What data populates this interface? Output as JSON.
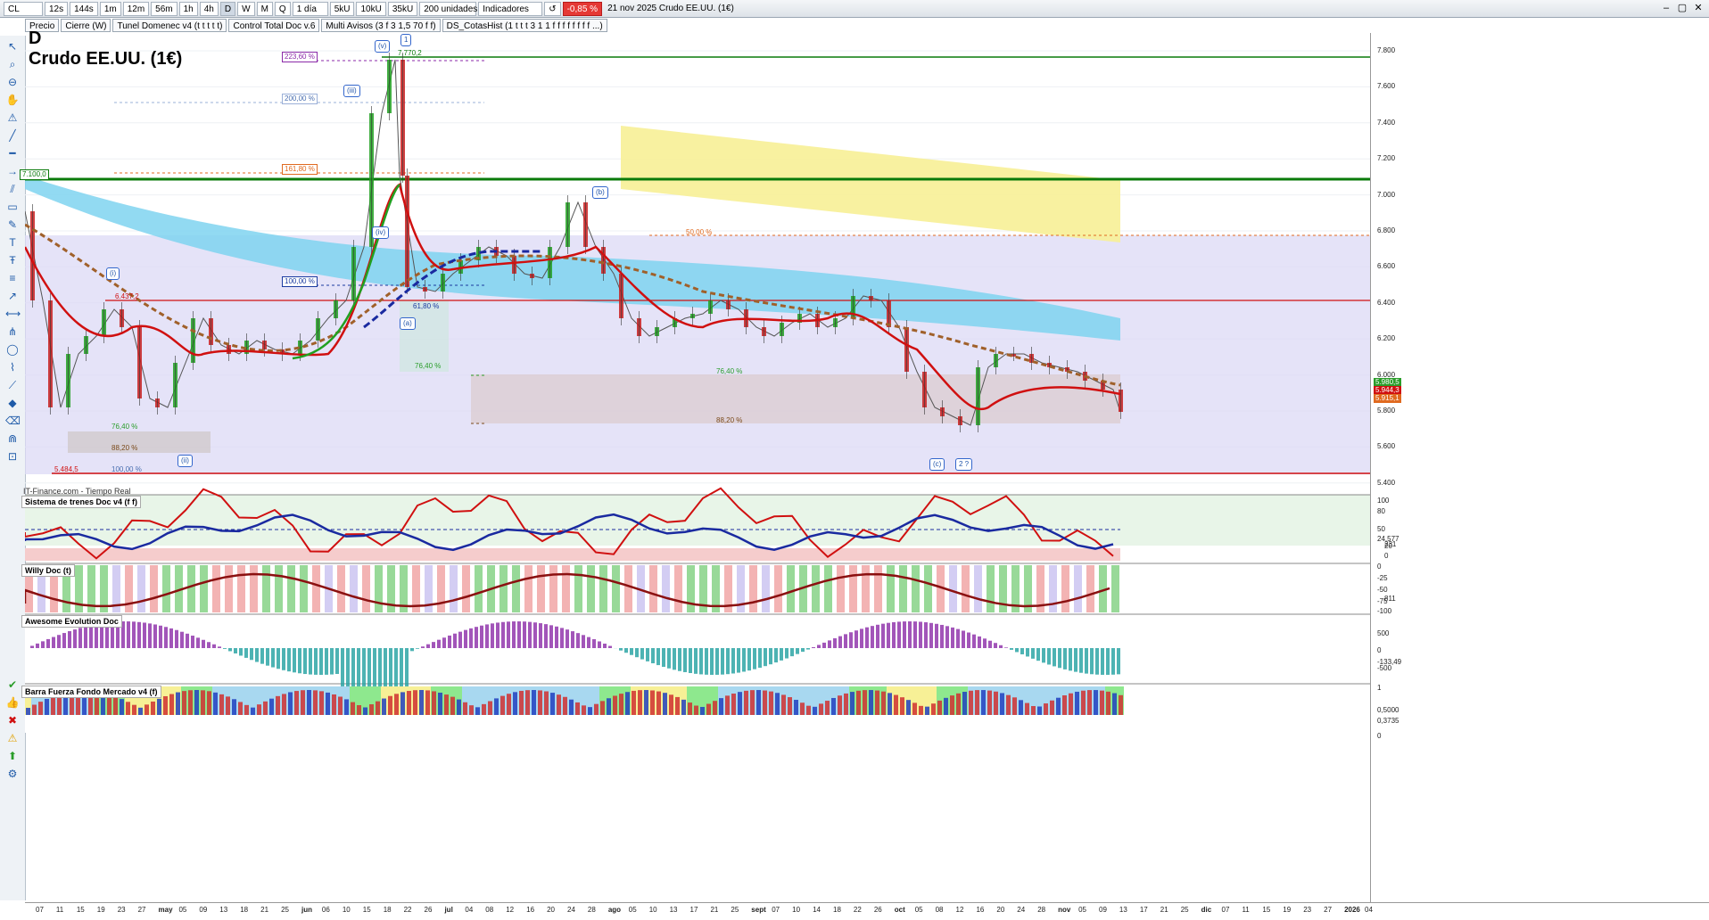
{
  "toolbar": {
    "symbol": "CL",
    "timeframes": [
      "12s",
      "144s",
      "1m",
      "12m",
      "56m",
      "1h",
      "4h",
      "D",
      "W",
      "M",
      "Q"
    ],
    "interval": "1 día",
    "units": [
      "5kU",
      "10kU",
      "35kU"
    ],
    "quantity": "200 unidades",
    "indicators_label": "Indicadores",
    "change_pct": "-0,85 %",
    "header_text": "21 nov 2025 Crudo EE.UU. (1€)"
  },
  "indicator_tabs": [
    "Precio",
    "Cierre (W)",
    "Tunel Domenec v4 (t t t t t)",
    "Control Total Doc v.6",
    "Multi Avisos (3 f 3 1,5 70 f f)",
    "DS_CotasHist (1 t t t 3 1 1 f f f f f f f f ...)"
  ],
  "chart": {
    "interval_code": "D",
    "instrument_name": "Crudo EE.UU. (1€)",
    "data_source": "IT-Finance.com - Tiempo Real"
  },
  "panels": [
    {
      "title": "Sistema de trenes Doc v4 (f f)"
    },
    {
      "title": "Willy Doc (t)"
    },
    {
      "title": "Awesome Evolution Doc"
    },
    {
      "title": "Barra Fuerza Fondo Mercado v4 (f)"
    }
  ],
  "fib_labels": [
    "223,60 %",
    "200,00 %",
    "161,80 %",
    "100,00 %",
    "61,80 %",
    "76,40 %",
    "50,00 %",
    "76,40 %",
    "88,20 %",
    "76,40 %",
    "88,20 %",
    "100,00 %"
  ],
  "level_labels": [
    "7.770,2",
    "7.100,0",
    "6.437,2",
    "5.484,5"
  ],
  "wave_labels": [
    "(v)",
    "1",
    "(iii)",
    "(iv)",
    "(i)",
    "(ii)",
    "(a)",
    "(b)",
    "(c)",
    "2 ?"
  ],
  "price_axis": [
    "7.800",
    "7.600",
    "7.400",
    "7.200",
    "7.000",
    "6.800",
    "6.600",
    "6.400",
    "6.200",
    "6.000",
    "5.800",
    "5.600",
    "5.400"
  ],
  "price_tags": [
    "5.980,5",
    "5.944,3",
    "5.915,1"
  ],
  "osc_axis": {
    "trenes": [
      "100",
      "80",
      "50",
      "24,577",
      "20",
      "231",
      "0"
    ],
    "willy": [
      "0",
      "-25",
      "-50",
      "-75",
      "-100",
      "811"
    ],
    "awesome": [
      "500",
      "0",
      "-133,49",
      "-500"
    ],
    "barra": [
      "1",
      "0,5000",
      "0,3735",
      "0"
    ]
  },
  "time_axis": [
    "07",
    "11",
    "15",
    "19",
    "23",
    "27",
    "may",
    "05",
    "09",
    "13",
    "18",
    "21",
    "25",
    "jun",
    "06",
    "10",
    "15",
    "18",
    "22",
    "26",
    "jul",
    "04",
    "08",
    "12",
    "16",
    "20",
    "24",
    "28",
    "ago",
    "05",
    "10",
    "13",
    "17",
    "21",
    "25",
    "sept",
    "07",
    "10",
    "14",
    "18",
    "22",
    "26",
    "oct",
    "05",
    "08",
    "12",
    "16",
    "20",
    "24",
    "28",
    "nov",
    "05",
    "09",
    "13",
    "17",
    "21",
    "25",
    "dic",
    "07",
    "11",
    "15",
    "19",
    "23",
    "27",
    "2026",
    "04"
  ],
  "colors": {
    "bullish": "#21a021",
    "bearish": "#c81e1e",
    "resistance": "#0a7a0a",
    "support": "#d01010",
    "cloud_blue": "#7fd4f0",
    "cloud_yellow": "#f7f096",
    "range_violet": "#dcd9f5"
  }
}
